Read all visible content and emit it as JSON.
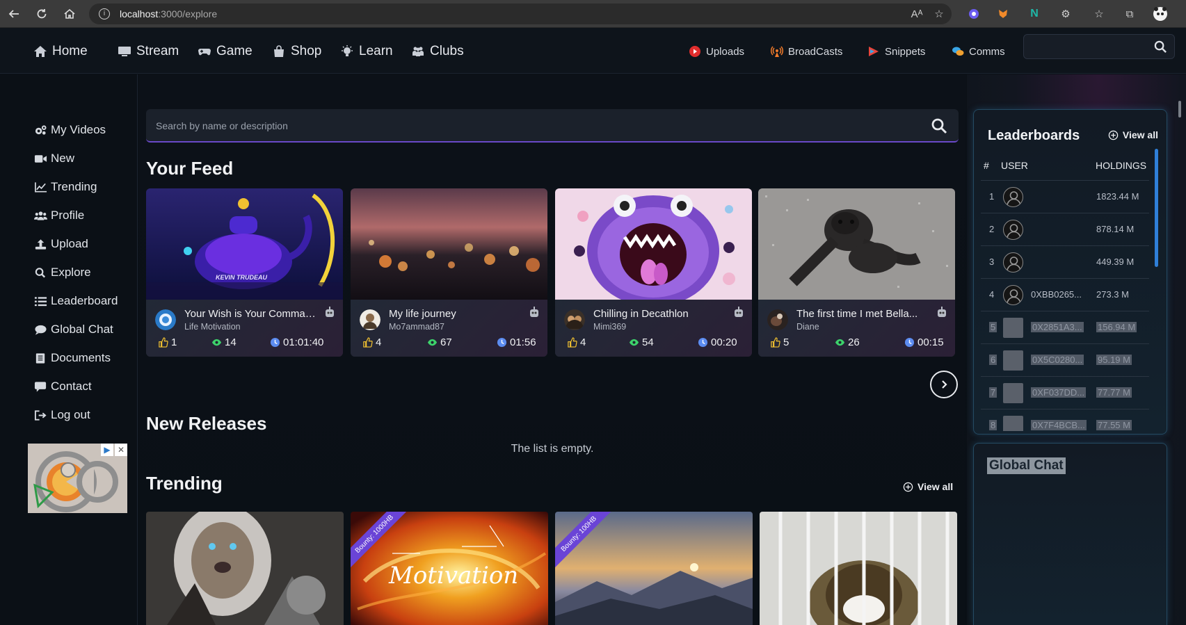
{
  "browser": {
    "url_host": "localhost",
    "url_path": ":3000/explore"
  },
  "nav": {
    "items": [
      {
        "label": "Home",
        "icon": "home-icon"
      },
      {
        "label": "Stream",
        "icon": "monitor-icon"
      },
      {
        "label": "Game",
        "icon": "gamepad-icon"
      },
      {
        "label": "Shop",
        "icon": "shopping-bag-icon"
      },
      {
        "label": "Learn",
        "icon": "lightbulb-icon"
      },
      {
        "label": "Clubs",
        "icon": "people-icon"
      }
    ],
    "right_items": [
      {
        "label": "Uploads",
        "icon": "youtube-icon",
        "color": "#e02d2d"
      },
      {
        "label": "BroadCasts",
        "icon": "broadcast-icon",
        "color": "#f07a2a"
      },
      {
        "label": "Snippets",
        "icon": "play-icon",
        "color": "#e8453c"
      },
      {
        "label": "Comms",
        "icon": "chat-bubbles-icon",
        "color": "#f0a030"
      }
    ]
  },
  "sidebar": {
    "items": [
      {
        "label": "My Videos",
        "icon": "gears-icon"
      },
      {
        "label": "New",
        "icon": "video-camera-icon"
      },
      {
        "label": "Trending",
        "icon": "line-chart-icon"
      },
      {
        "label": "Profile",
        "icon": "users-icon"
      },
      {
        "label": "Upload",
        "icon": "upload-icon"
      },
      {
        "label": "Explore",
        "icon": "search-icon"
      },
      {
        "label": "Leaderboard",
        "icon": "list-icon"
      },
      {
        "label": "Global Chat",
        "icon": "comment-icon"
      },
      {
        "label": "Documents",
        "icon": "document-icon"
      },
      {
        "label": "Contact",
        "icon": "comment-alt-icon"
      },
      {
        "label": "Log out",
        "icon": "sign-out-icon"
      }
    ]
  },
  "main": {
    "search_placeholder": "Search by name or description",
    "feed_title": "Your Feed",
    "feed": [
      {
        "title": "Your Wish is Your Comman...",
        "author": "Life Motivation",
        "likes": "1",
        "views": "14",
        "duration": "01:01:40",
        "thumb_overlay": "KEVIN TRUDEAU"
      },
      {
        "title": "My life journey",
        "author": "Mo7ammad87",
        "likes": "4",
        "views": "67",
        "duration": "01:56"
      },
      {
        "title": "Chilling in Decathlon",
        "author": "Mimi369",
        "likes": "4",
        "views": "54",
        "duration": "00:20"
      },
      {
        "title": "The first time I met Bella...",
        "author": "Diane",
        "likes": "5",
        "views": "26",
        "duration": "00:15"
      }
    ],
    "new_releases_title": "New Releases",
    "new_releases_empty": "The list is empty.",
    "trending_title": "Trending",
    "trending_view_all": "View all",
    "trending": [
      {
        "ribbon": ""
      },
      {
        "ribbon": "Bounty: 1000HB",
        "overlay": "Motivation"
      },
      {
        "ribbon": "Bounty: 100HB"
      },
      {
        "ribbon": ""
      }
    ]
  },
  "leaderboard": {
    "title": "Leaderboards",
    "view_all": "View all",
    "headers": {
      "rank": "#",
      "user": "USER",
      "holdings": "HOLDINGS"
    },
    "rows": [
      {
        "rank": "1",
        "user": "",
        "holdings": "1823.44 M"
      },
      {
        "rank": "2",
        "user": "",
        "holdings": "878.14 M"
      },
      {
        "rank": "3",
        "user": "",
        "holdings": "449.39 M"
      },
      {
        "rank": "4",
        "user": "0XBB0265...",
        "holdings": "273.3 M"
      },
      {
        "rank": "5",
        "user": "0X2851A3...",
        "holdings": "156.94 M"
      },
      {
        "rank": "6",
        "user": "0X5C0280...",
        "holdings": "95.19 M"
      },
      {
        "rank": "7",
        "user": "0XF037DD...",
        "holdings": "77.77 M"
      },
      {
        "rank": "8",
        "user": "0X7F4BCB...",
        "holdings": "77.55 M"
      }
    ]
  },
  "global_chat": {
    "title": "Global Chat"
  },
  "colors": {
    "accent_purple": "#6a49c8",
    "accent_blue": "#2f7fd8",
    "views_green": "#3dd36b",
    "like_yellow": "#f2c230",
    "clock_blue": "#5c8cf0"
  }
}
